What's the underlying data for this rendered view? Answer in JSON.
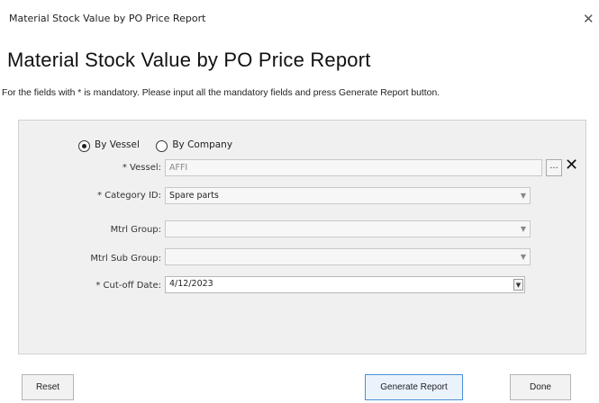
{
  "window": {
    "title": "Material Stock Value by PO Price Report",
    "close_icon": "close-icon"
  },
  "page": {
    "heading": "Material Stock Value by PO Price Report",
    "instructions": "For the fields with * is mandatory. Please input all the mandatory fields and press Generate Report button."
  },
  "filter": {
    "mode_options": [
      {
        "label": "By Vessel",
        "selected": true
      },
      {
        "label": "By Company",
        "selected": false
      }
    ],
    "vessel": {
      "label": "* Vessel:",
      "value": "AFFI",
      "browse_label": "...",
      "clear_icon": "clear-icon"
    },
    "category": {
      "label": "* Category ID:",
      "value": "Spare parts"
    },
    "mtrl_group": {
      "label": "Mtrl Group:",
      "value": ""
    },
    "mtrl_sub_group": {
      "label": "Mtrl Sub Group:",
      "value": ""
    },
    "cutoff_date": {
      "label": "* Cut-off Date:",
      "value": "4/12/2023"
    }
  },
  "buttons": {
    "reset": "Reset",
    "generate": "Generate Report",
    "done": "Done"
  }
}
